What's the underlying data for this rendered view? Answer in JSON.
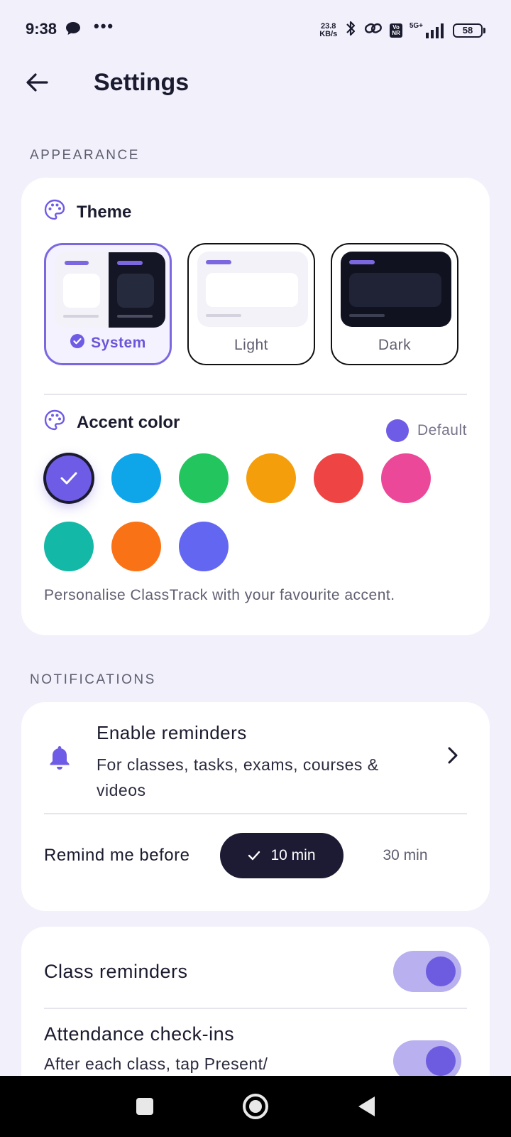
{
  "status_bar": {
    "time": "9:38",
    "dots": "•••",
    "speed_value": "23.8",
    "speed_unit": "KB/s",
    "volte_top": "Vo",
    "volte_bottom": "NR",
    "network_type": "5G+",
    "battery": "58"
  },
  "header": {
    "title": "Settings"
  },
  "appearance": {
    "section_label": "APPEARANCE",
    "theme": {
      "label": "Theme",
      "options": [
        {
          "label": "System",
          "selected": true
        },
        {
          "label": "Light",
          "selected": false
        },
        {
          "label": "Dark",
          "selected": false
        }
      ]
    },
    "accent": {
      "label": "Accent color",
      "current_label": "Default",
      "current_color": "#6f5ce6",
      "swatches": [
        "#6f5ce6",
        "#0ea5e9",
        "#22c55e",
        "#f59e0b",
        "#ef4444",
        "#ec4899",
        "#14b8a6",
        "#f97316",
        "#6366f1"
      ],
      "hint": "Personalise ClassTrack with your favourite accent."
    }
  },
  "notifications": {
    "section_label": "NOTIFICATIONS",
    "enable_title": "Enable reminders",
    "enable_subtitle": "For classes, tasks, exams, courses & videos",
    "remind_label": "Remind me before",
    "remind_options": [
      {
        "label": "10 min",
        "selected": true
      },
      {
        "label": "30 min",
        "selected": false
      }
    ]
  },
  "toggles": {
    "class_reminders": {
      "label": "Class reminders",
      "on": true
    },
    "attendance": {
      "label": "Attendance check-ins",
      "subtitle": "After each class, tap Present/",
      "on": true
    }
  },
  "colors": {
    "accent": "#6f5ce6",
    "background": "#f1f0fb",
    "chip_dark": "#1d1b34"
  }
}
